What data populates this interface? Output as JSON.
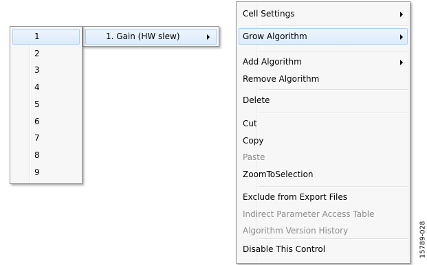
{
  "number_menu": {
    "items": [
      "1",
      "2",
      "3",
      "4",
      "5",
      "6",
      "7",
      "8",
      "9"
    ],
    "highlighted": "1"
  },
  "instance_menu": {
    "items": [
      {
        "label": "1. Gain (HW slew)",
        "has_submenu": true
      }
    ]
  },
  "context_menu": {
    "groups": [
      [
        {
          "label": "Cell Settings",
          "has_submenu": true,
          "disabled": false
        }
      ],
      [
        {
          "label": "Grow Algorithm",
          "has_submenu": true,
          "disabled": false,
          "highlighted": true
        }
      ],
      [
        {
          "label": "Add Algorithm",
          "has_submenu": true,
          "disabled": false
        },
        {
          "label": "Remove Algorithm",
          "has_submenu": false,
          "disabled": false
        }
      ],
      [
        {
          "label": "Delete",
          "has_submenu": false,
          "disabled": false
        }
      ],
      [
        {
          "label": "Cut",
          "has_submenu": false,
          "disabled": false
        },
        {
          "label": "Copy",
          "has_submenu": false,
          "disabled": false
        },
        {
          "label": "Paste",
          "has_submenu": false,
          "disabled": true
        },
        {
          "label": "ZoomToSelection",
          "has_submenu": false,
          "disabled": false
        }
      ],
      [
        {
          "label": "Exclude from Export Files",
          "has_submenu": false,
          "disabled": false
        },
        {
          "label": "Indirect Parameter Access Table",
          "has_submenu": false,
          "disabled": true
        },
        {
          "label": "Algorithm Version History",
          "has_submenu": false,
          "disabled": true
        }
      ],
      [
        {
          "label": "Disable This Control",
          "has_submenu": false,
          "disabled": false
        }
      ]
    ]
  },
  "figure_id": "15789-028",
  "colors": {
    "menu_bg": "#f7f7f7",
    "menu_border": "#979797",
    "highlight_border": "#a8d1f5",
    "disabled_text": "#8d8d8d"
  }
}
